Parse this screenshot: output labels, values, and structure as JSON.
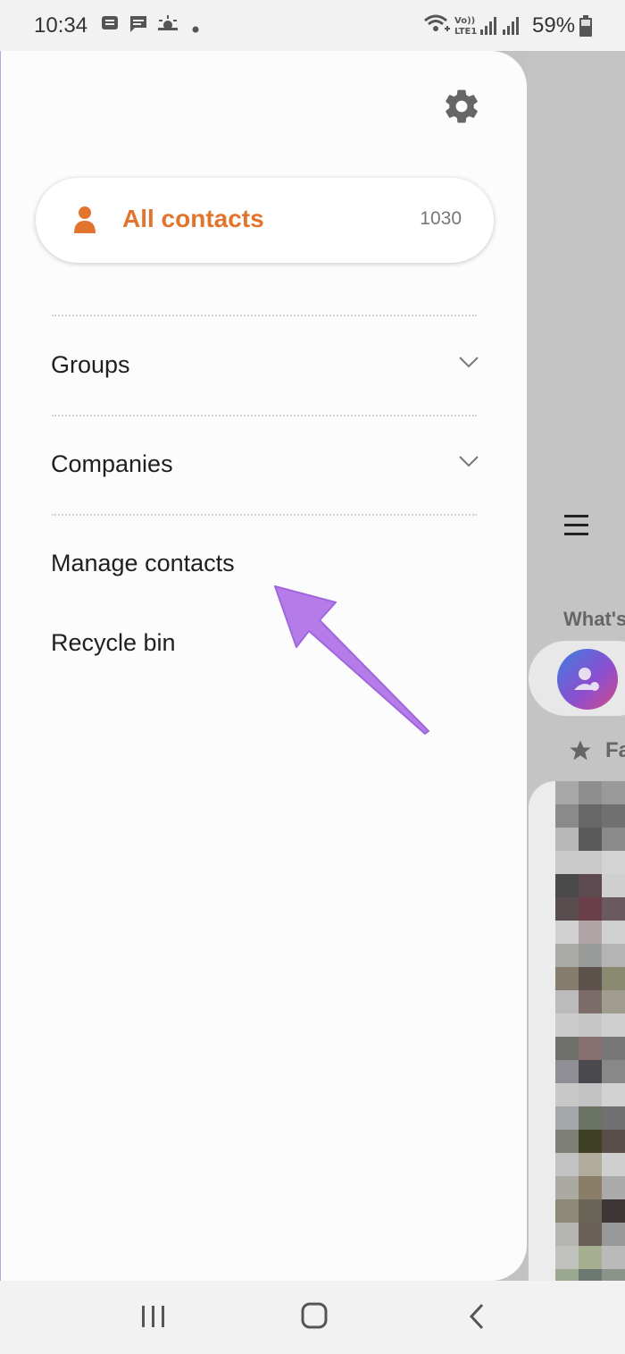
{
  "status_bar": {
    "time": "10:34",
    "battery_percent": "59%",
    "notification_icons": [
      "message-icon",
      "chat-icon",
      "weather-icon",
      "dot-icon"
    ],
    "system_icons": [
      "wifi-calling-icon",
      "volte-lte-icon",
      "signal-icon",
      "signal-icon",
      "battery-icon"
    ]
  },
  "drawer": {
    "settings_icon": "gear-icon",
    "all_contacts": {
      "label": "All contacts",
      "count": "1030",
      "icon": "person-icon",
      "color": "#e2742d"
    },
    "items": [
      {
        "label": "Groups",
        "expandable": true
      },
      {
        "label": "Companies",
        "expandable": true
      },
      {
        "label": "Manage contacts",
        "expandable": false
      },
      {
        "label": "Recycle bin",
        "expandable": false
      }
    ]
  },
  "background_app": {
    "menu_icon": "hamburger-icon",
    "section_label": "What's",
    "favorites_label": "Fa"
  },
  "annotation": {
    "arrow_color": "#b57be8"
  },
  "nav_bar": {
    "buttons": [
      "recents-icon",
      "home-icon",
      "back-icon"
    ]
  }
}
